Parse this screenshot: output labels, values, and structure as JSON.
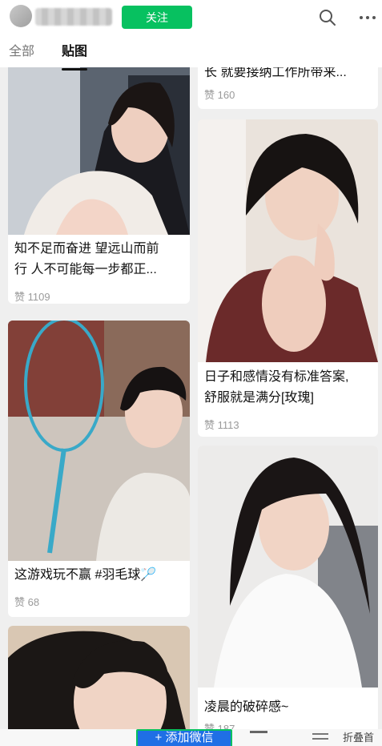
{
  "header": {
    "follow_label": "关注",
    "search_icon": "search-icon",
    "more_icon": "more-icon"
  },
  "tabs": [
    {
      "label": "全部",
      "active": false
    },
    {
      "label": "贴图",
      "active": true
    }
  ],
  "feed": {
    "left": [
      {
        "caption": "",
        "likes": "赞 1109",
        "caption_lines": [
          "知不足而奋进 望远山而前",
          "行 人不可能每一步都正..."
        ]
      },
      {
        "caption": "这游戏玩不赢 #羽毛球🏸",
        "likes": "赞 68"
      },
      {
        "caption": "",
        "likes": ""
      }
    ],
    "right": [
      {
        "caption": "长 就要接纳工作所带来...",
        "likes": "赞 160"
      },
      {
        "caption_lines": [
          "日子和感情没有标准答案,",
          "舒服就是满分[玫瑰]"
        ],
        "likes": "赞 1113"
      },
      {
        "caption": "凌晨的破碎感~",
        "likes": "赞 187"
      }
    ]
  },
  "bottom": {
    "add_wechat_label": "+ 添加微信",
    "right_text": "折叠首"
  },
  "colors": {
    "accent_green": "#07c160",
    "background": "#efefef",
    "card": "#ffffff",
    "likes_grey": "#9a9a9a"
  }
}
